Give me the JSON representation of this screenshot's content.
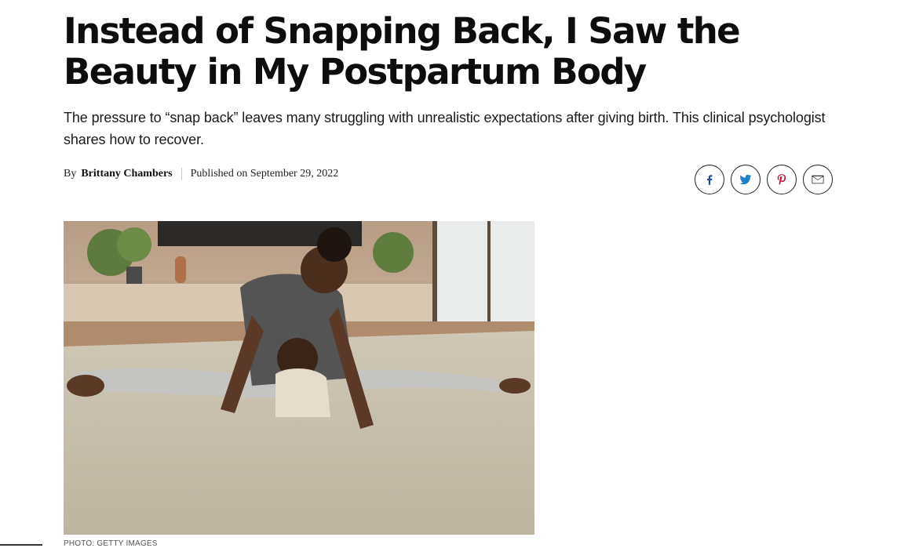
{
  "article": {
    "headline": "Instead of Snapping Back, I Saw the Beauty in My Postpartum Body",
    "dek": "The pressure to “snap back” leaves many struggling with unrealistic expectations after giving birth. This clinical psychologist shares how to recover.",
    "byline": {
      "prefix": "By",
      "author": "Brittany Chambers",
      "published": "Published on September 29, 2022"
    },
    "image_credit": "PHOTO: GETTY IMAGES"
  },
  "share": [
    {
      "name": "facebook-icon",
      "color": "#1f4fa0"
    },
    {
      "name": "twitter-icon",
      "color": "#1d7fc4"
    },
    {
      "name": "pinterest-icon",
      "color": "#c8102e"
    },
    {
      "name": "email-icon",
      "color": "#222222"
    }
  ],
  "colors": {
    "text": "#111111",
    "divider": "#cccccc",
    "icon_border": "#222222"
  }
}
